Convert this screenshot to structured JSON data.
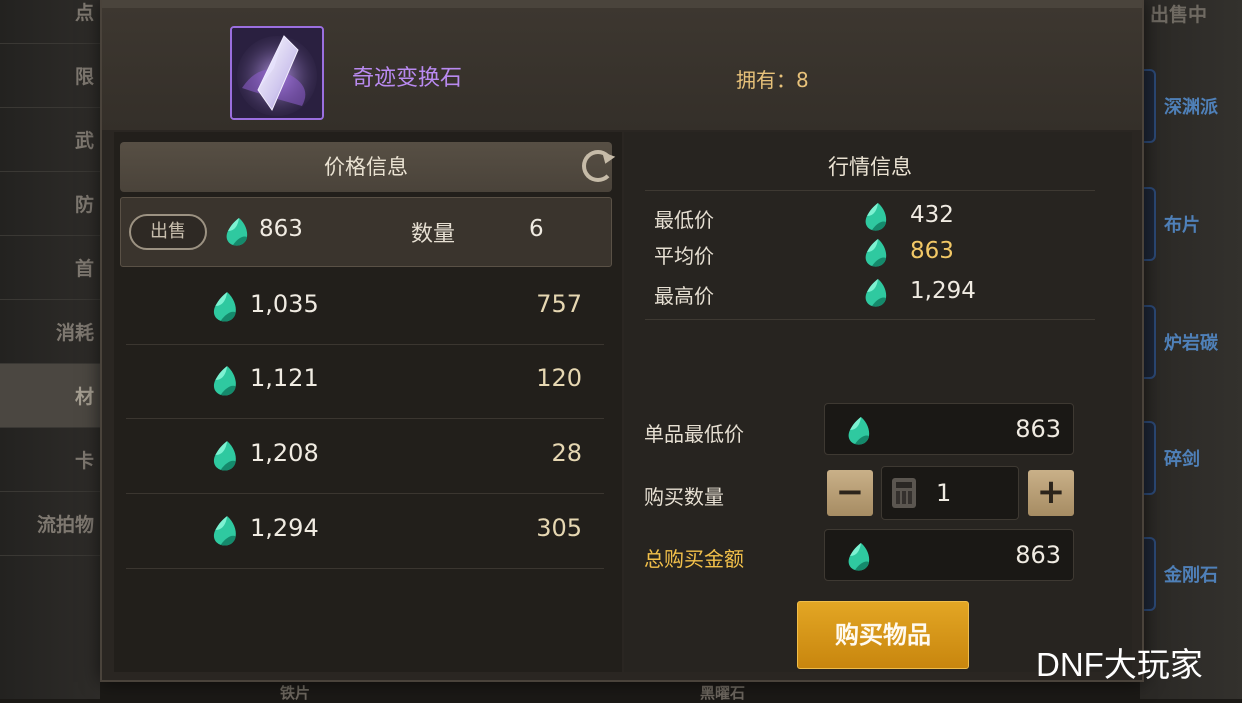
{
  "background": {
    "left_menu": [
      "点",
      "限",
      "武",
      "防",
      "首",
      "消耗",
      "材",
      "卡",
      "流拍物"
    ],
    "right_top": "出售中",
    "right_items": [
      "深渊派",
      "布片",
      "炉岩碳",
      "碎剑",
      "金刚石"
    ],
    "bottom_items": [
      "铁片",
      "黑曜石"
    ]
  },
  "item": {
    "name": "奇迹变换石",
    "owned_label": "拥有：8"
  },
  "price_info": {
    "title": "价格信息",
    "sell_label": "出售",
    "qty_label": "数量",
    "first": {
      "price": "863",
      "qty": "6"
    },
    "listings": [
      {
        "price": "1,035",
        "qty": "757"
      },
      {
        "price": "1,121",
        "qty": "120"
      },
      {
        "price": "1,208",
        "qty": "28"
      },
      {
        "price": "1,294",
        "qty": "305"
      }
    ]
  },
  "market_info": {
    "title": "行情信息",
    "lowest_label": "最低价",
    "lowest_value": "432",
    "average_label": "平均价",
    "average_value": "863",
    "highest_label": "最高价",
    "highest_value": "1,294"
  },
  "purchase": {
    "unit_min_label": "单品最低价",
    "unit_min_value": "863",
    "qty_label": "购买数量",
    "qty_value": "1",
    "minus": "−",
    "plus": "+",
    "total_label": "总购买金额",
    "total_value": "863",
    "buy_button": "购买物品"
  },
  "watermark": "DNF大玩家",
  "colors": {
    "accent_gold": "#e3a624",
    "item_purple": "#b98af0",
    "gem_teal": "#3fd8b0"
  },
  "icons": [
    "gem-icon",
    "refresh-icon",
    "calculator-icon",
    "crystal-item-icon"
  ]
}
